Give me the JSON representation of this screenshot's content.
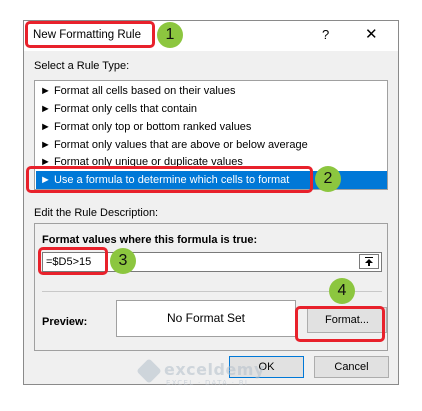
{
  "dialog": {
    "title": "New Formatting Rule",
    "help_label": "?",
    "close_label": "✕",
    "select_rule_type_label": "Select a Rule Type:",
    "rule_types": [
      {
        "label": "► Format all cells based on their values",
        "selected": false
      },
      {
        "label": "► Format only cells that contain",
        "selected": false
      },
      {
        "label": "► Format only top or bottom ranked values",
        "selected": false
      },
      {
        "label": "► Format only values that are above or below average",
        "selected": false
      },
      {
        "label": "► Format only unique or duplicate values",
        "selected": false
      },
      {
        "label": "► Use a formula to determine which cells to format",
        "selected": true
      }
    ],
    "edit_description_label": "Edit the Rule Description:",
    "formula_label": "Format values where this formula is true:",
    "formula_value": "=$D5>15",
    "preview_label": "Preview:",
    "preview_text": "No Format Set",
    "format_button": "Format...",
    "ok_button": "OK",
    "cancel_button": "Cancel"
  },
  "steps": [
    "1",
    "2",
    "3",
    "4"
  ],
  "colors": {
    "callout": "#e8212b",
    "step_badge": "#8cc63f",
    "selection": "#0078d7"
  },
  "watermark": {
    "name": "exceldemy",
    "tagline": "EXCEL · DATA · BI"
  }
}
